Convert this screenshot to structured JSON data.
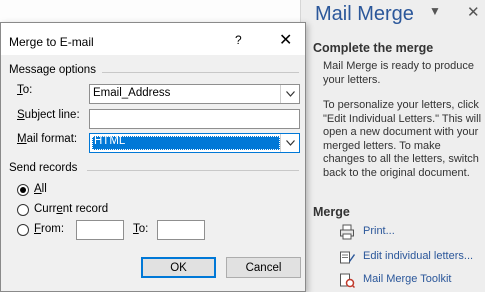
{
  "task_pane": {
    "title": "Mail Merge",
    "complete_heading": "Complete the merge",
    "ready_text": "Mail Merge is ready to produce your letters.",
    "instructions_text": "To personalize your letters, click \"Edit Individual Letters.\" This will open a new document with your merged letters. To make changes to all the letters, switch back to the original document.",
    "merge_heading": "Merge",
    "links": [
      {
        "label": "Print...",
        "icon": "printer-icon"
      },
      {
        "label": "Edit individual letters...",
        "icon": "edit-letters-icon"
      },
      {
        "label": "Mail Merge Toolkit",
        "icon": "toolkit-icon"
      }
    ]
  },
  "dialog": {
    "title": "Merge to E-mail",
    "help": "?",
    "close": "✕",
    "message_options": {
      "group_label": "Message options",
      "to_label": "To:",
      "to_value": "Email_Address",
      "subject_label": "Subject line:",
      "subject_value": "",
      "format_label": "Mail format:",
      "format_value": "HTML"
    },
    "send_records": {
      "group_label": "Send records",
      "all_label": "All",
      "current_label": "Current record",
      "from_label": "From:",
      "to_label": "To:",
      "selected": "All"
    },
    "ok_label": "OK",
    "cancel_label": "Cancel"
  },
  "colors": {
    "accent": "#0078d7",
    "pane_title": "#2b579a"
  }
}
